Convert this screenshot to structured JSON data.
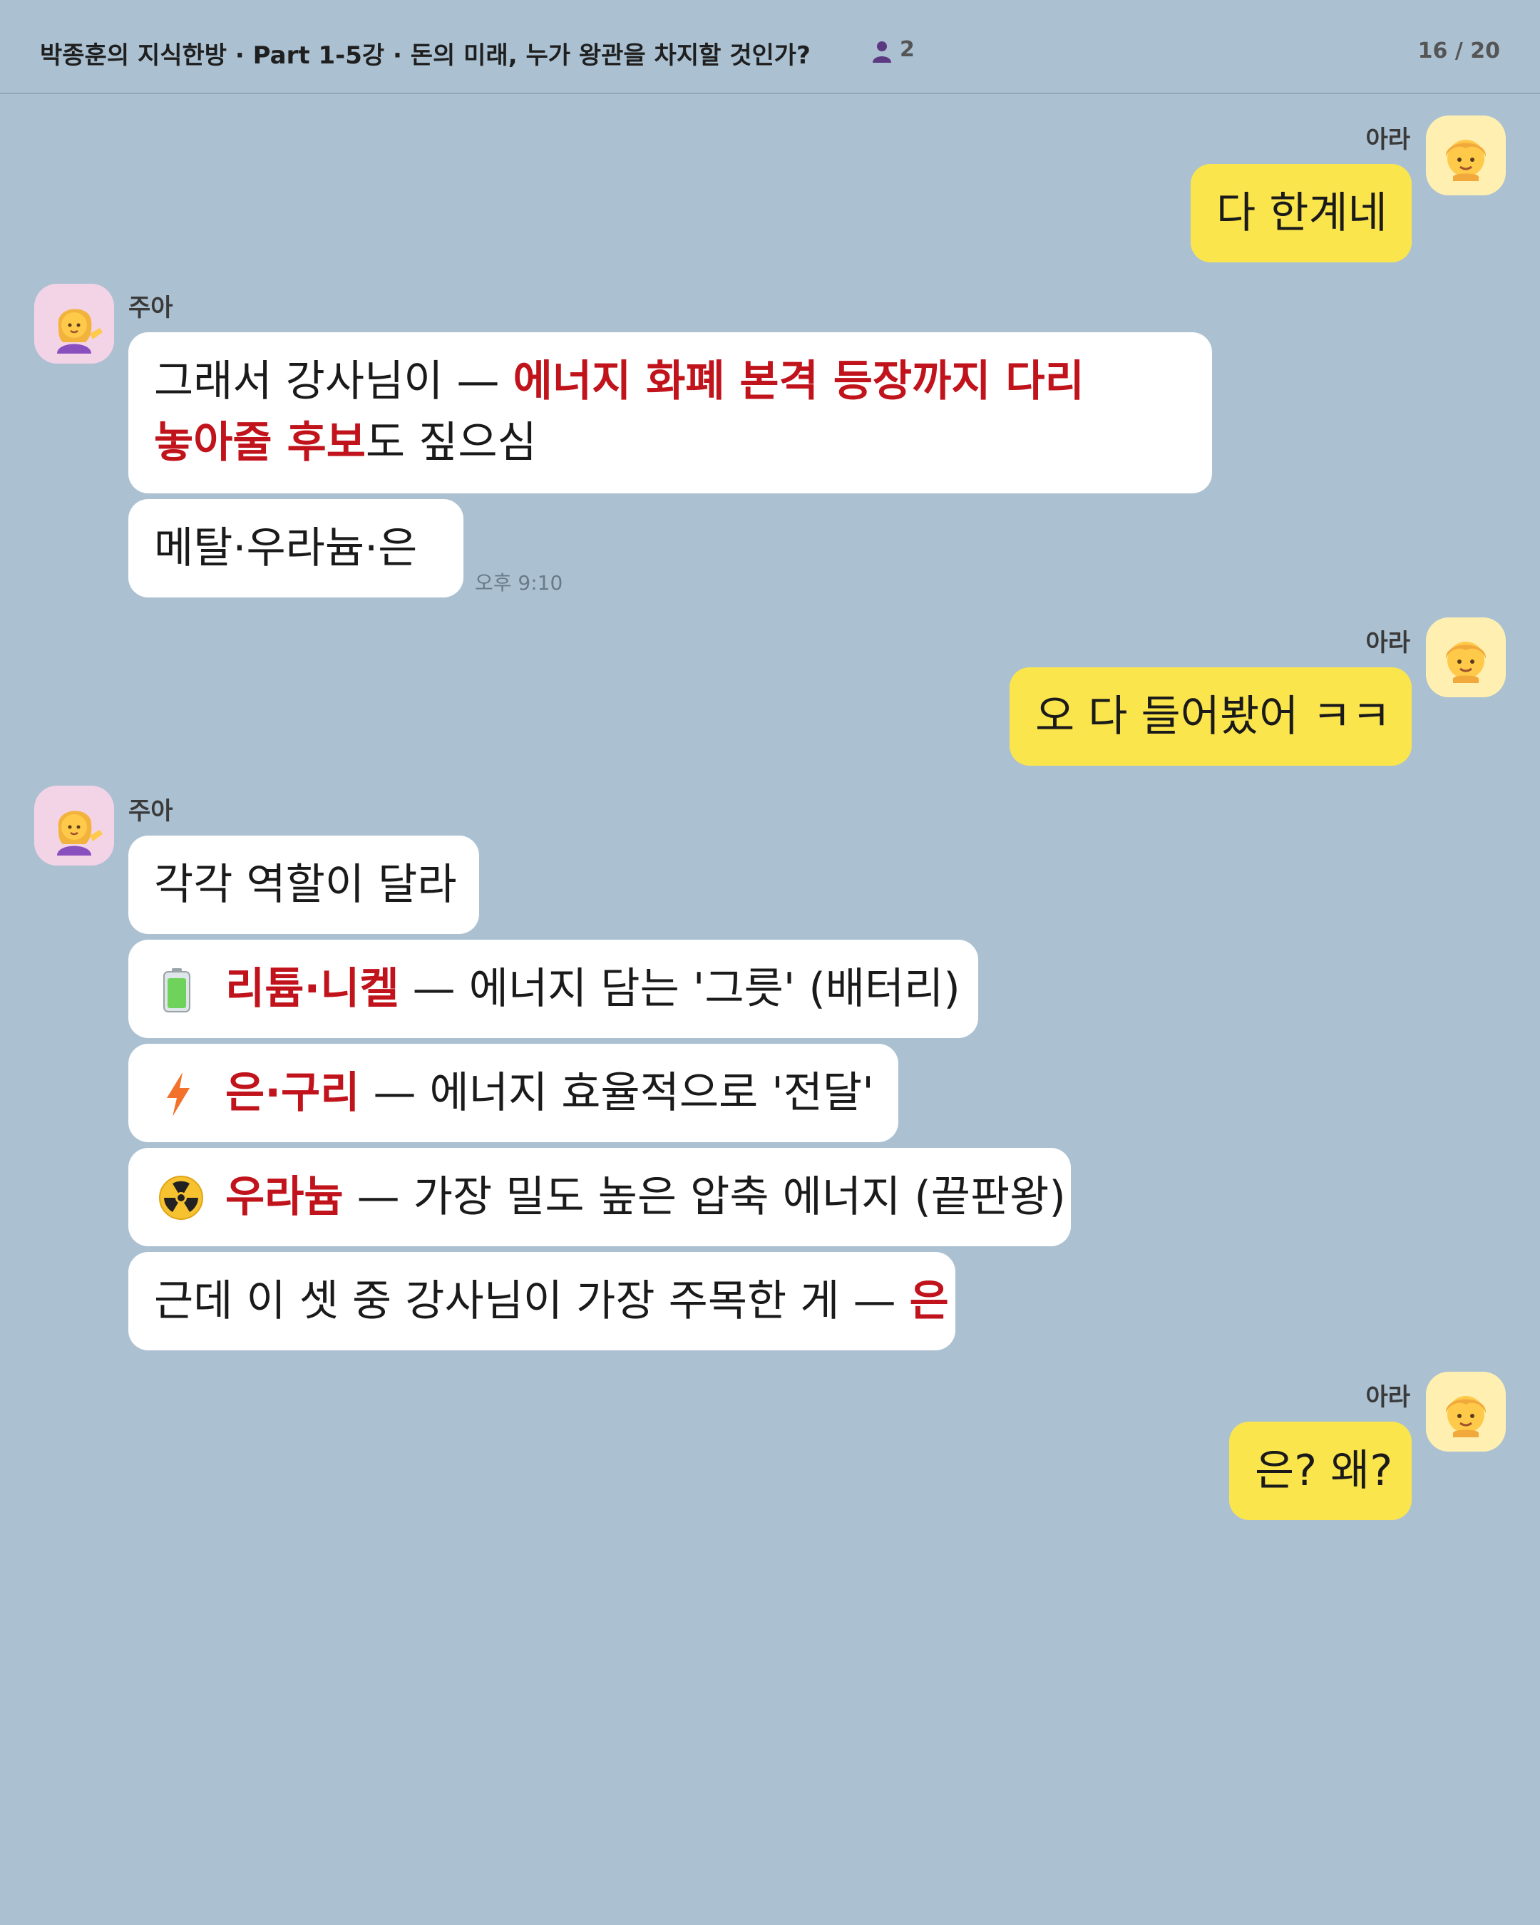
{
  "header": {
    "title": "박종훈의 지식한방 · Part 1-5강 · 돈의 미래, 누가 왕관을 차지할 것인가?",
    "member_count": "2",
    "page_counter": "16 / 20"
  },
  "people": {
    "me": "아라",
    "other": "주아"
  },
  "messages": {
    "m1": "다 한계네",
    "m2_plain1": "그래서 강사님이 — ",
    "m2_red1": "에너지 화폐 본격 등장까지 다리",
    "m2_red2": "놓아줄 후보",
    "m2_plain2": "도 짚으심",
    "m3": "메탈·우라늄·은",
    "m3_time": "오후 9:10",
    "m4": "오 다 들어봤어 ㅋㅋ",
    "m5": "각각 역할이 달라",
    "m6_red": "리튬·니켈",
    "m6_plain": " — 에너지 담는 '그릇' (배터리)",
    "m7_red": "은·구리",
    "m7_plain": " — 에너지 효율적으로 '전달'",
    "m8_red": "우라늄",
    "m8_plain": " — 가장 밀도 높은 압축 에너지 (끝판왕)",
    "m9_plain": "근데 이 셋 중 강사님이 가장 주목한 게 — ",
    "m9_red": "은",
    "m10": "은? 왜?"
  },
  "icons": {
    "member": "person-icon",
    "battery": "battery-icon",
    "lightning": "lightning-icon",
    "radioactive": "radioactive-icon",
    "me_avatar": "blonde-child-emoji",
    "other_avatar": "tipping-hand-woman-emoji"
  },
  "colors": {
    "background": "#abc1d2",
    "my_bubble": "#fbe54d",
    "other_bubble": "#ffffff",
    "highlight": "#c1131b"
  }
}
